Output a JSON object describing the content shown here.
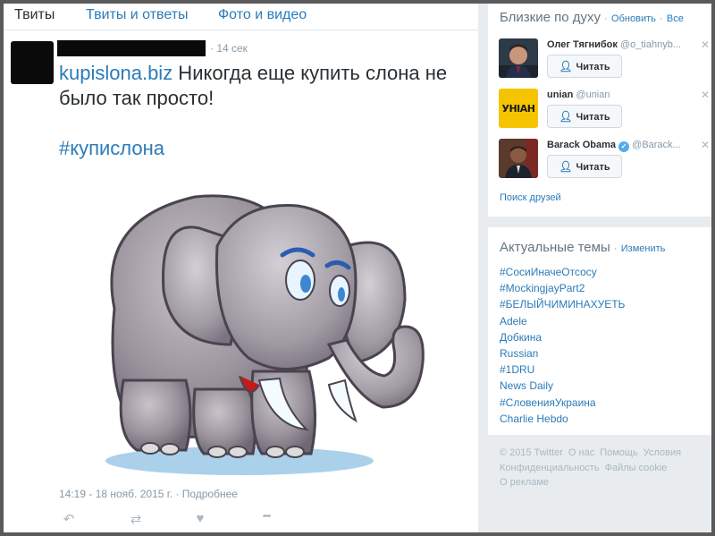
{
  "tabs": [
    {
      "label": "Твиты"
    },
    {
      "label": "Твиты и ответы"
    },
    {
      "label": "Фото и видео"
    }
  ],
  "tweet": {
    "time": "· 14 сек",
    "link_text": "kupislona.biz",
    "text": " Никогда еще купить слона не было так просто!",
    "hashtag": "#купислона",
    "timestamp": "14:19 - 18 нояб. 2015 г.",
    "details_link": "Подробнее",
    "actions": [
      {
        "icon": "reply-icon",
        "glyph": "↶"
      },
      {
        "icon": "retweet-icon",
        "glyph": "⇄"
      },
      {
        "icon": "like-icon",
        "glyph": "♥"
      },
      {
        "icon": "more-icon",
        "glyph": "•••"
      }
    ]
  },
  "who_to_follow": {
    "title": "Близкие по духу",
    "refresh": "Обновить",
    "separator": "·",
    "all": "Все",
    "follow_label": "Читать",
    "close_glyph": "✕",
    "suggestions": [
      {
        "name": "Олег Тягнибок",
        "handle": "@o_tiahnyb..."
      },
      {
        "name": "unian",
        "handle": "@unian",
        "avatar_text": "УНІАН"
      },
      {
        "name": "Barack Obama",
        "handle": "@Barack...",
        "verified": true
      }
    ],
    "find_friends": "Поиск друзей"
  },
  "trends": {
    "title": "Актуальные темы",
    "change": "Изменить",
    "items": [
      "#СосиИначеОтсосу",
      "#MockingjayPart2",
      "#БЕЛЫЙЧИМИНАХУЕТЬ",
      "Adele",
      "Добкина",
      "Russian",
      "#1DRU",
      "News Daily",
      "#СловенияУкраина",
      "Charlie Hebdo"
    ]
  },
  "footer": {
    "items": [
      "© 2015 Twitter",
      "О нас",
      "Помощь",
      "Условия",
      "Конфиденциальность",
      "Файлы cookie",
      "О рекламе"
    ]
  },
  "colors": {
    "link": "#2b7bb9",
    "text": "#292f33",
    "muted": "#8899a6",
    "background": "#e8ecee"
  }
}
